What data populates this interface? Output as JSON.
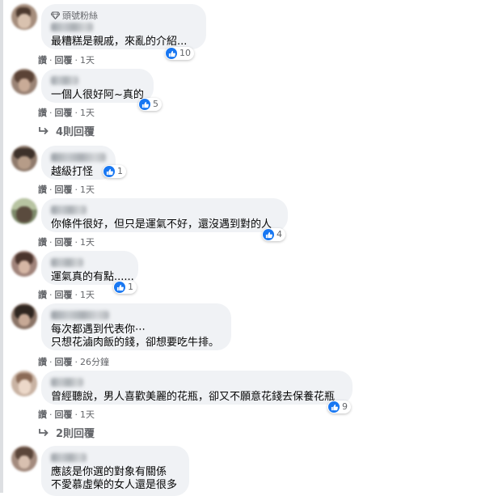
{
  "colors": {
    "bubble": "#f0f2f5",
    "like_blue": "#1877f2",
    "meta_gray": "#65676b"
  },
  "comments": [
    {
      "badge": "頭號粉絲",
      "text": [
        "最糟糕是親戚，來亂的介紹..."
      ],
      "reactions": "10",
      "actions": {
        "like": "讚",
        "reply": "回覆",
        "time": "1天"
      }
    },
    {
      "text": [
        "一個人很好阿~真的"
      ],
      "reactions": "5",
      "actions": {
        "like": "讚",
        "reply": "回覆",
        "time": "1天"
      },
      "replies": "4則回覆"
    },
    {
      "text": [
        "越級打怪"
      ],
      "reactions": "1",
      "actions": {
        "like": "讚",
        "reply": "回覆",
        "time": "1天"
      }
    },
    {
      "text": [
        "你條件很好，但只是運氣不好，還沒遇到對的人"
      ],
      "reactions": "4",
      "actions": {
        "like": "讚",
        "reply": "回覆",
        "time": "1天"
      }
    },
    {
      "text": [
        "運氣真的有點......"
      ],
      "reactions": "1",
      "actions": {
        "like": "讚",
        "reply": "回覆",
        "time": "1天"
      }
    },
    {
      "text": [
        "每次都遇到代表你⋯",
        "只想花滷肉飯的錢，卻想要吃牛排。"
      ],
      "actions": {
        "like": "讚",
        "reply": "回覆",
        "time": "26分鐘"
      }
    },
    {
      "text": [
        "曾經聽說，男人喜歡美麗的花瓶，卻又不願意花錢去保養花瓶"
      ],
      "reactions": "9",
      "actions": {
        "like": "讚",
        "reply": "回覆",
        "time": "1天"
      },
      "replies": "2則回覆"
    },
    {
      "text": [
        "應該是你選的對象有關係",
        "不愛慕虛榮的女人還是很多"
      ]
    }
  ]
}
